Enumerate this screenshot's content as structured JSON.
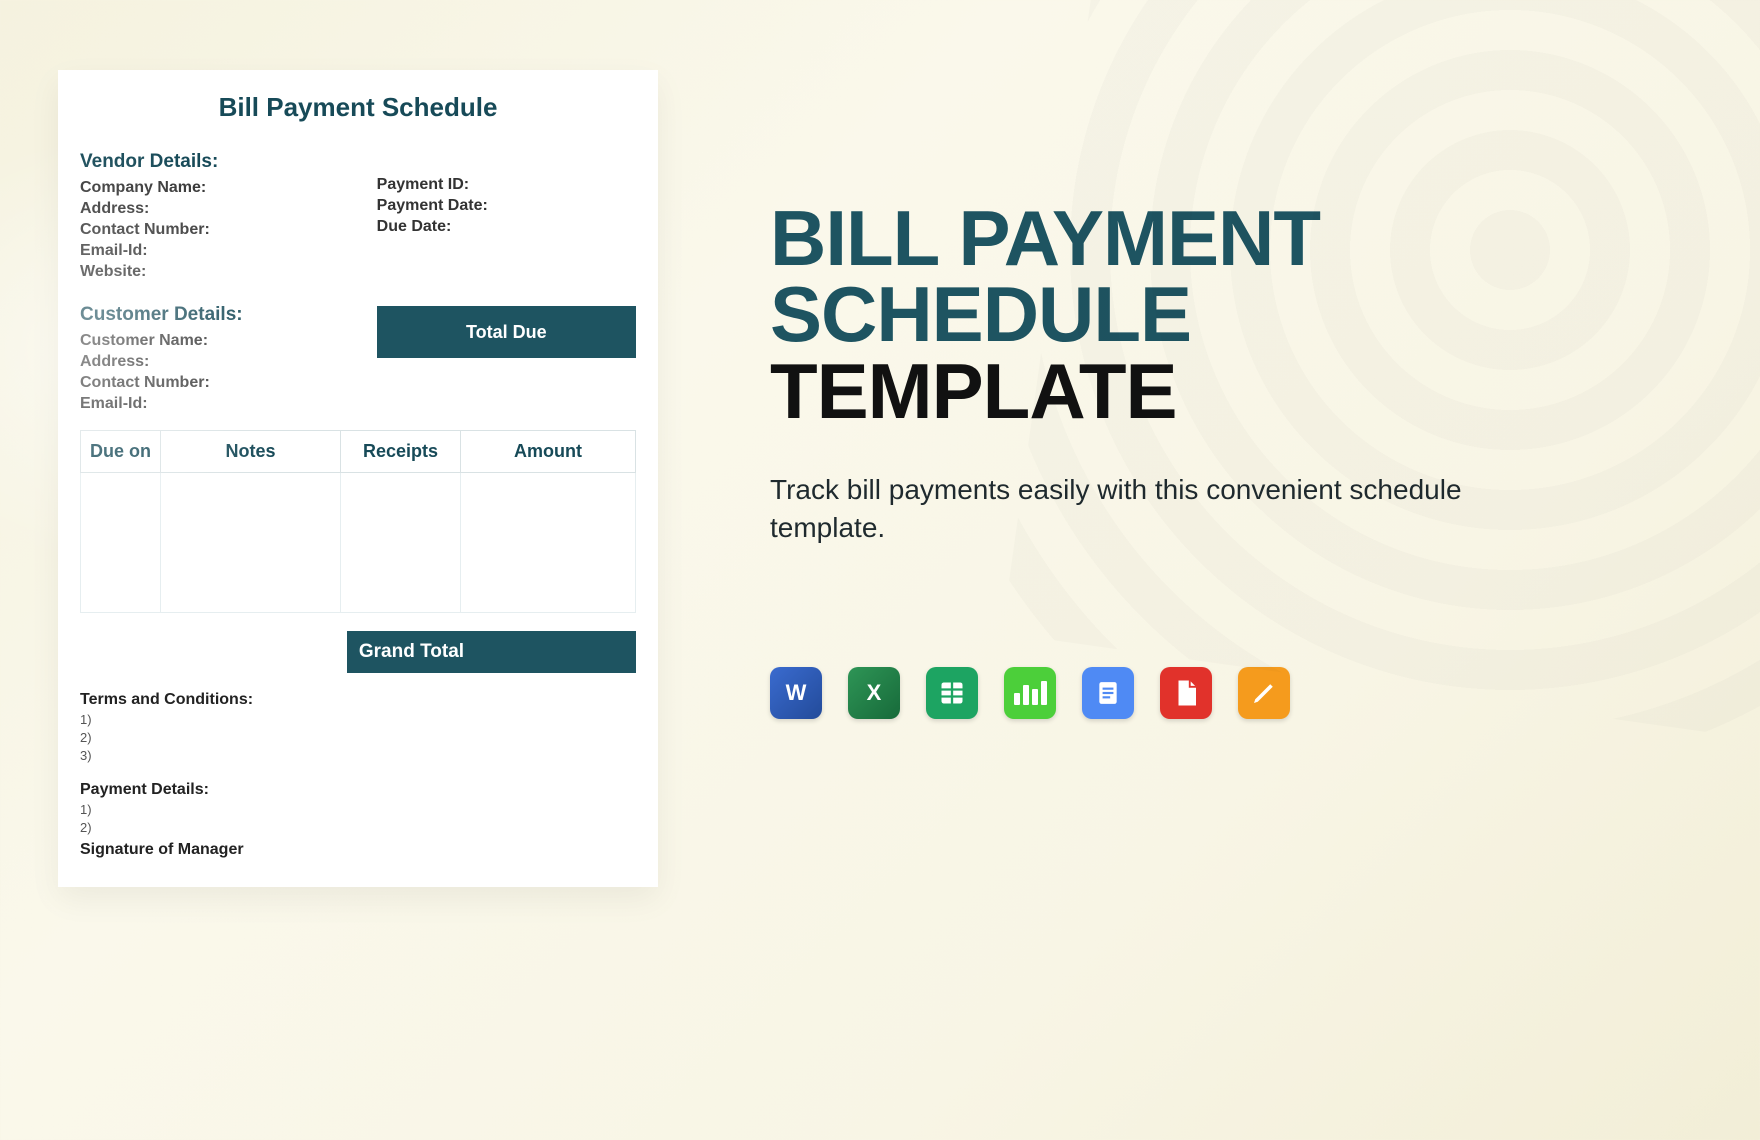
{
  "doc": {
    "title": "Bill Payment Schedule",
    "vendor": {
      "heading": "Vendor Details:",
      "company": "Company Name:",
      "address": "Address:",
      "contact": "Contact Number:",
      "email": "Email-Id:",
      "website": "Website:"
    },
    "paymentMeta": {
      "id": "Payment ID:",
      "date": "Payment Date:",
      "due": "Due Date:"
    },
    "customer": {
      "heading": "Customer Details:",
      "name": "Customer Name:",
      "address": "Address:",
      "contact": "Contact Number:",
      "email": "Email-Id:"
    },
    "totalDue": "Total Due",
    "table": {
      "headers": [
        "Due on",
        "Notes",
        "Receipts",
        "Amount"
      ]
    },
    "grandTotal": "Grand Total",
    "terms": {
      "heading": "Terms and Conditions:",
      "items": [
        "1)",
        "2)",
        "3)"
      ]
    },
    "paymentDetails": {
      "heading": "Payment Details:",
      "items": [
        "1)",
        "2)"
      ]
    },
    "signature": "Signature of Manager"
  },
  "hero": {
    "line1": "BILL PAYMENT",
    "line2": "SCHEDULE",
    "line3": "TEMPLATE",
    "subtitle": "Track bill payments easily with this convenient schedule template."
  },
  "icons": {
    "word": "W",
    "excel": "X",
    "pdf": "PDF"
  }
}
